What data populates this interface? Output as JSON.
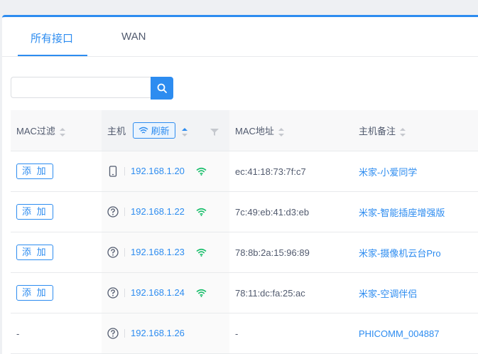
{
  "tabs": [
    {
      "label": "所有接口",
      "active": true
    },
    {
      "label": "WAN",
      "active": false
    }
  ],
  "search": {
    "placeholder": "",
    "value": ""
  },
  "columns": {
    "mac_filter": "MAC过滤",
    "host": "主机",
    "refresh": "刷新",
    "mac_address": "MAC地址",
    "host_note": "主机备注"
  },
  "rows": [
    {
      "filter": "添 加",
      "device_icon": "phone-icon",
      "ip": "192.168.1.20",
      "wifi": true,
      "mac": "ec:41:18:73:7f:c7",
      "note": "米家-小爱同学"
    },
    {
      "filter": "添 加",
      "device_icon": "unknown-device-icon",
      "ip": "192.168.1.22",
      "wifi": true,
      "mac": "7c:49:eb:41:d3:eb",
      "note": "米家-智能插座增强版"
    },
    {
      "filter": "添 加",
      "device_icon": "unknown-device-icon",
      "ip": "192.168.1.23",
      "wifi": true,
      "mac": "78:8b:2a:15:96:89",
      "note": "米家-摄像机云台Pro"
    },
    {
      "filter": "添 加",
      "device_icon": "unknown-device-icon",
      "ip": "192.168.1.24",
      "wifi": true,
      "mac": "78:11:dc:fa:25:ac",
      "note": "米家-空调伴侣"
    },
    {
      "filter": "-",
      "device_icon": "unknown-device-icon",
      "ip": "192.168.1.26",
      "wifi": false,
      "mac": "-",
      "note": "PHICOMM_004887"
    }
  ],
  "colors": {
    "accent": "#2d8cf0",
    "wifi": "#19be6b"
  }
}
